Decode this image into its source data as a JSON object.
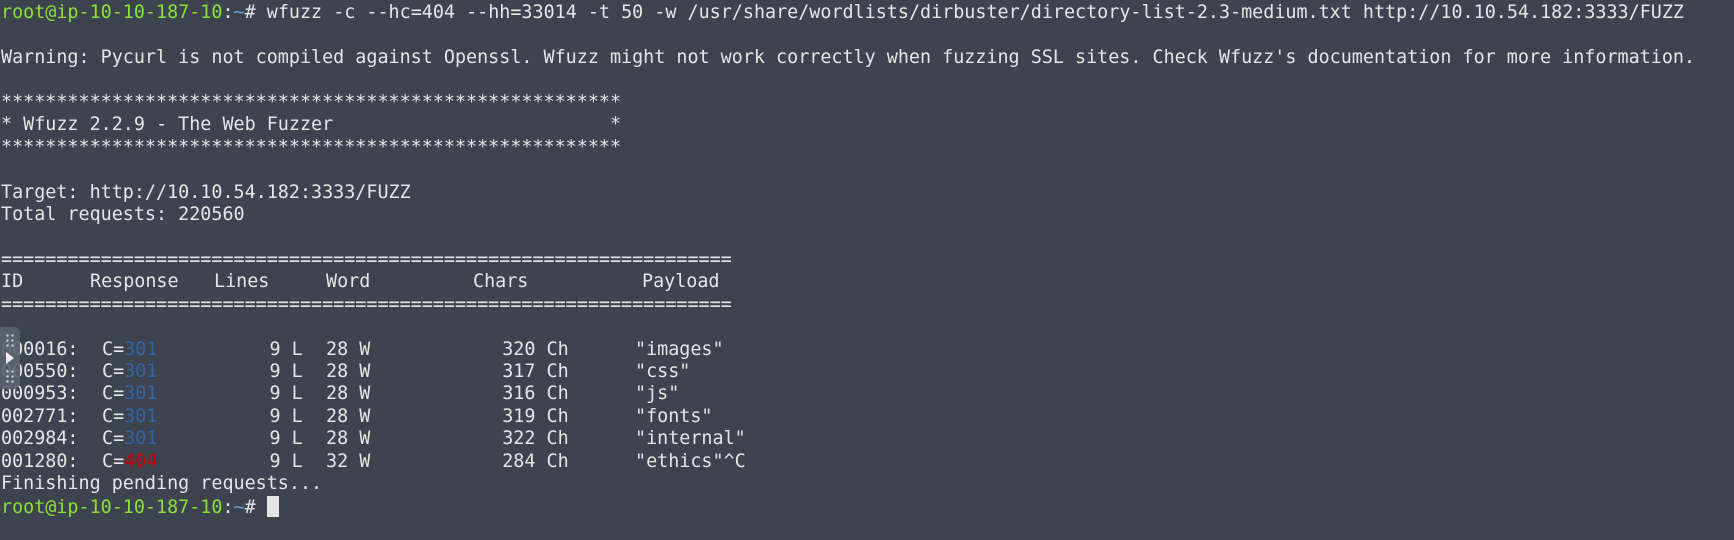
{
  "prompt": {
    "user_host": "root@ip-10-10-187-10",
    "colon": ":",
    "path": "~",
    "symbol": "# "
  },
  "command": "wfuzz -c --hc=404 --hh=33014 -t 50 -w /usr/share/wordlists/dirbuster/directory-list-2.3-medium.txt http://10.10.54.182:3333/FUZZ",
  "warning": "Warning: Pycurl is not compiled against Openssl. Wfuzz might not work correctly when fuzzing SSL sites. Check Wfuzz's documentation for more information.",
  "banner": {
    "stars": "********************************************************",
    "title": "* Wfuzz 2.2.9 - The Web Fuzzer                         *"
  },
  "target": "Target: http://10.10.54.182:3333/FUZZ",
  "total_requests": "Total requests: 220560",
  "separator": "==================================================================",
  "table": {
    "headers": {
      "id": "ID",
      "response": "Response",
      "lines": "Lines",
      "word": "Word",
      "chars": "Chars",
      "payload": "Payload"
    },
    "rows": [
      {
        "id": "000016:",
        "c_prefix": "C=",
        "code": "301",
        "lines": "9 L",
        "words": "28 W",
        "chars": "320 Ch",
        "payload": "\"images\""
      },
      {
        "id": "000550:",
        "c_prefix": "C=",
        "code": "301",
        "lines": "9 L",
        "words": "28 W",
        "chars": "317 Ch",
        "payload": "\"css\""
      },
      {
        "id": "000953:",
        "c_prefix": "C=",
        "code": "301",
        "lines": "9 L",
        "words": "28 W",
        "chars": "316 Ch",
        "payload": "\"js\""
      },
      {
        "id": "002771:",
        "c_prefix": "C=",
        "code": "301",
        "lines": "9 L",
        "words": "28 W",
        "chars": "319 Ch",
        "payload": "\"fonts\""
      },
      {
        "id": "002984:",
        "c_prefix": "C=",
        "code": "301",
        "lines": "9 L",
        "words": "28 W",
        "chars": "322 Ch",
        "payload": "\"internal\""
      },
      {
        "id": "001280:",
        "c_prefix": "C=",
        "code": "404",
        "lines": "9 L",
        "words": "32 W",
        "chars": "284 Ch",
        "payload": "\"ethics\"^C"
      }
    ]
  },
  "finishing": "Finishing pending requests...",
  "colors": {
    "background": "#3d4450",
    "prompt_user": "#8ae234",
    "prompt_path": "#729fcf",
    "code_301": "#3465a4",
    "code_404": "#cc0000"
  }
}
